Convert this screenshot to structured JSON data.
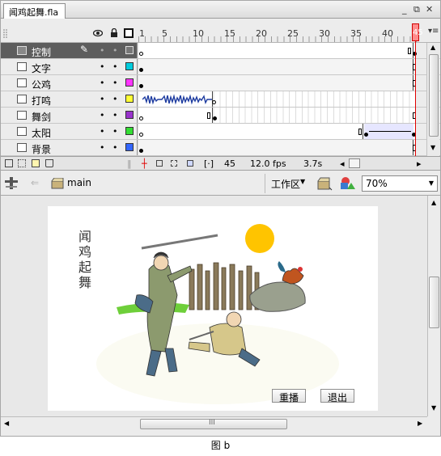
{
  "document_tab": "闻鸡起舞.fla",
  "window_controls": {
    "minimize": "_",
    "restore": "⧉",
    "close": "✕"
  },
  "header_icons": {
    "eye": "eye-icon",
    "lock": "lock-icon",
    "outline": "outline-icon"
  },
  "ruler": {
    "labels": [
      "1",
      "5",
      "10",
      "15",
      "20",
      "25",
      "30",
      "35",
      "40",
      "45"
    ],
    "current_frame_marker": "45"
  },
  "layers": [
    {
      "name": "控制",
      "selected": true,
      "color": "#777777",
      "eye": "•",
      "lock": "•"
    },
    {
      "name": "文字",
      "selected": false,
      "color": "#00ccdd",
      "eye": "•",
      "lock": "•"
    },
    {
      "name": "公鸡",
      "selected": false,
      "color": "#ff33ff",
      "eye": "•",
      "lock": "•"
    },
    {
      "name": "打鸣",
      "selected": false,
      "color": "#ffff33",
      "eye": "•",
      "lock": "•"
    },
    {
      "name": "舞剑",
      "selected": false,
      "color": "#9933cc",
      "eye": "•",
      "lock": "•"
    },
    {
      "name": "太阳",
      "selected": false,
      "color": "#33dd33",
      "eye": "•",
      "lock": "•"
    },
    {
      "name": "背景",
      "selected": false,
      "color": "#3366ff",
      "eye": "•",
      "lock": "•"
    }
  ],
  "status": {
    "current_frame": "45",
    "fps": "12.0 fps",
    "time": "3.7s"
  },
  "editbar": {
    "scene": "main",
    "workspace": "工作区",
    "zoom": "70%"
  },
  "stage": {
    "title": "闻鸡起舞",
    "replay_button": "重播",
    "exit_button": "退出"
  },
  "scroll_grip": "III",
  "caption": "图 b",
  "colors": {
    "playhead": "#e00000",
    "sun": "#ffc400",
    "selected_layer": "#5d5d5d"
  }
}
